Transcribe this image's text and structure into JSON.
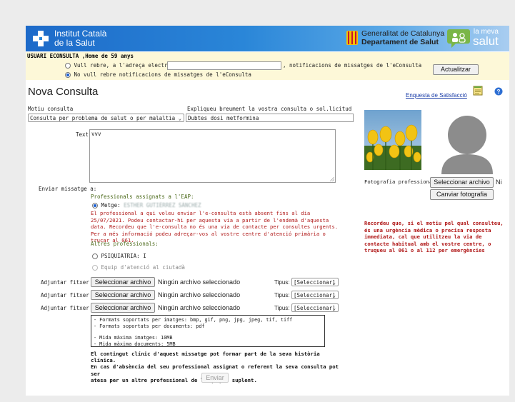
{
  "header": {
    "institution_line1": "Institut Català",
    "institution_line2": "de la Salut",
    "gov_line1": "Generalitat de Catalunya",
    "gov_line2": "Departament de Salut",
    "meva_line1": "la meva",
    "meva_line2": "salut"
  },
  "user_bar": {
    "title": "USUARI ECONSULTA ,Home de 59 anys",
    "option_email_label": "Vull rebre, a l'adreça electrònica",
    "email_value": "",
    "option_email_suffix": ", notificacions de missatges de l'eConsulta",
    "option_none_label": "No vull rebre notificacions de missatges de l'eConsulta",
    "update_button": "Actualitzar"
  },
  "page": {
    "title": "Nova Consulta",
    "survey_link": "Enquesta de Satisfacció"
  },
  "form": {
    "motive_label": "Motiu consulta",
    "motive_value": "Consulta per problema de salut o per malaltia",
    "explain_label": "Expliqueu breument la vostra consulta o sol.licitud",
    "explain_value": "Dubtes dosi metformina",
    "text_label": "Text:",
    "text_value": "vvv",
    "send_to_label": "Enviar missatge a:",
    "assigned_heading": "Professionals assignats a l'EAP:",
    "doctor_prefix": "Metge:",
    "doctor_name": "ESTHER GUTIÉRREZ SÁNCHEZ",
    "absence_notice": "El professional a qui voleu enviar l'e-consulta està absent fins al dia 25/07/2021. Podeu contactar-hi per aquesta via a partir de l'endemà d'aquesta data. Recordeu que l'e-consulta no és una via de contacte per consultes urgents. Per a més informació podeu adreçar-vos al vostre centre d'atenció primària o trucar al 061.",
    "other_heading": "Altres professionals:",
    "other_option_1": "PSIQUIATRIA: I",
    "other_option_2": "Equip d'atenció al ciutadà",
    "attachments": [
      {
        "label": "Adjuntar fitxer 1:",
        "button": "Seleccionar archivo",
        "status": "Ningún archivo seleccionado",
        "type_label": "Tipus:",
        "type_value": "[Seleccionar]"
      },
      {
        "label": "Adjuntar fitxer 2:",
        "button": "Seleccionar archivo",
        "status": "Ningún archivo seleccionado",
        "type_label": "Tipus:",
        "type_value": "[Seleccionar]"
      },
      {
        "label": "Adjuntar fitxer 3:",
        "button": "Seleccionar archivo",
        "status": "Ningún archivo seleccionado",
        "type_label": "Tipus:",
        "type_value": "[Seleccionar]"
      }
    ],
    "formats_images": "- Formats soportats per imatges: bmp, gif, png, jpg, jpeg, tif, tiff",
    "formats_docs": "- Formats soportats per documents: pdf",
    "max_images": "- Mida màxima imatges: 10MB",
    "max_docs": "- Mida màxima documents: 5MB",
    "clinical_note_1": "El contingut clínic d'aquest missatge pot formar part de la seva història clínica.",
    "clinical_note_2": "En cas d'absència del seu professional assignat o referent la seva consulta pot ser",
    "clinical_note_3": "atesa per un altre professional de l'equip o suplent.",
    "send_button": "Enviar"
  },
  "side": {
    "photo_label": "Fotografia professional",
    "select_file_button": "Seleccionar archivo",
    "select_file_suffix": "Ni",
    "change_photo_button": "Canviar fotografia",
    "urgent_notice": "Recordeu que, si el motiu pel qual consulteu, és una urgència mèdica o precisa resposta immediata, cal que utilitzeu la via de contacte habitual amb el vostre centre, o truqueu al 061 o al 112 per emergències"
  },
  "colors": {
    "banner_start": "#1d6ac9",
    "banner_end": "#a9cdf0",
    "user_bar_bg": "#fdf8d8",
    "notice_red": "#b01818",
    "heading_green": "#4d6b1c"
  }
}
